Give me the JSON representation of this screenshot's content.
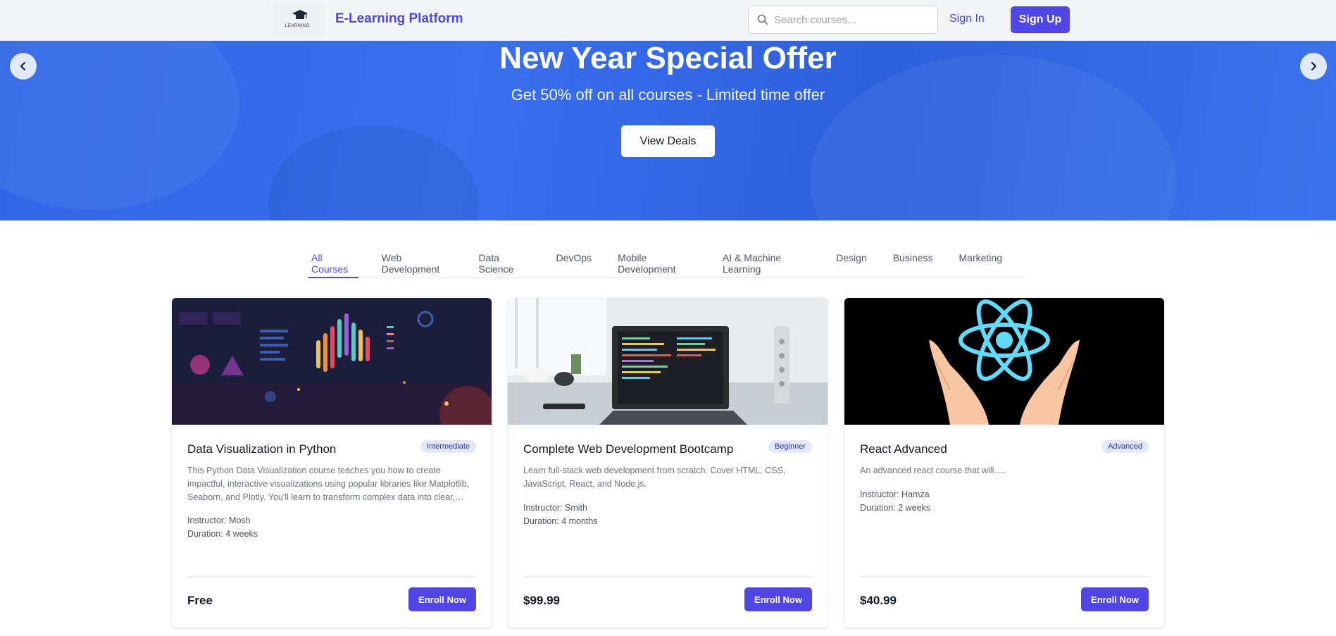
{
  "header": {
    "logo_text": "LEARNING",
    "brand": "E-Learning Platform",
    "search_placeholder": "Search courses...",
    "signin_label": "Sign In",
    "signup_label": "Sign Up"
  },
  "hero": {
    "title": "New Year Special Offer",
    "subtitle": "Get 50% off on all courses - Limited time offer",
    "button_label": "View Deals",
    "prev_icon": "chevron-left-icon",
    "next_icon": "chevron-right-icon"
  },
  "tabs": [
    {
      "label": "All Courses",
      "active": true
    },
    {
      "label": "Web Development",
      "active": false
    },
    {
      "label": "Data Science",
      "active": false
    },
    {
      "label": "DevOps",
      "active": false
    },
    {
      "label": "Mobile Development",
      "active": false
    },
    {
      "label": "AI & Machine Learning",
      "active": false
    },
    {
      "label": "Design",
      "active": false
    },
    {
      "label": "Business",
      "active": false
    },
    {
      "label": "Marketing",
      "active": false
    }
  ],
  "courses": [
    {
      "title": "Data Visualization in Python",
      "level": "Intermediate",
      "description": "This Python Data Visualization course teaches you how to create impactful, interactive visualizations using popular libraries like Matplotlib, Seaborn, and Plotly. You'll learn to transform complex data into clear, insightful charts.",
      "instructor": "Instructor: Mosh",
      "duration": "Duration: 4 weeks",
      "price": "Free",
      "enroll_label": "Enroll Now"
    },
    {
      "title": "Complete Web Development Bootcamp",
      "level": "Beginner",
      "description": "Learn full-stack web development from scratch. Cover HTML, CSS, JavaScript, React, and Node.js.",
      "instructor": "Instructor: Smith",
      "duration": "Duration: 4 months",
      "price": "$99.99",
      "enroll_label": "Enroll Now"
    },
    {
      "title": "React Advanced",
      "level": "Advanced",
      "description": "An advanced react course that will.....",
      "instructor": "Instructor: Hamza",
      "duration": "Duration: 2 weeks",
      "price": "$40.99",
      "enroll_label": "Enroll Now"
    }
  ],
  "colors": {
    "accent": "#4f46e5",
    "hero_blue": "#3a6ff0",
    "badge_bg": "#e0e7ff"
  }
}
